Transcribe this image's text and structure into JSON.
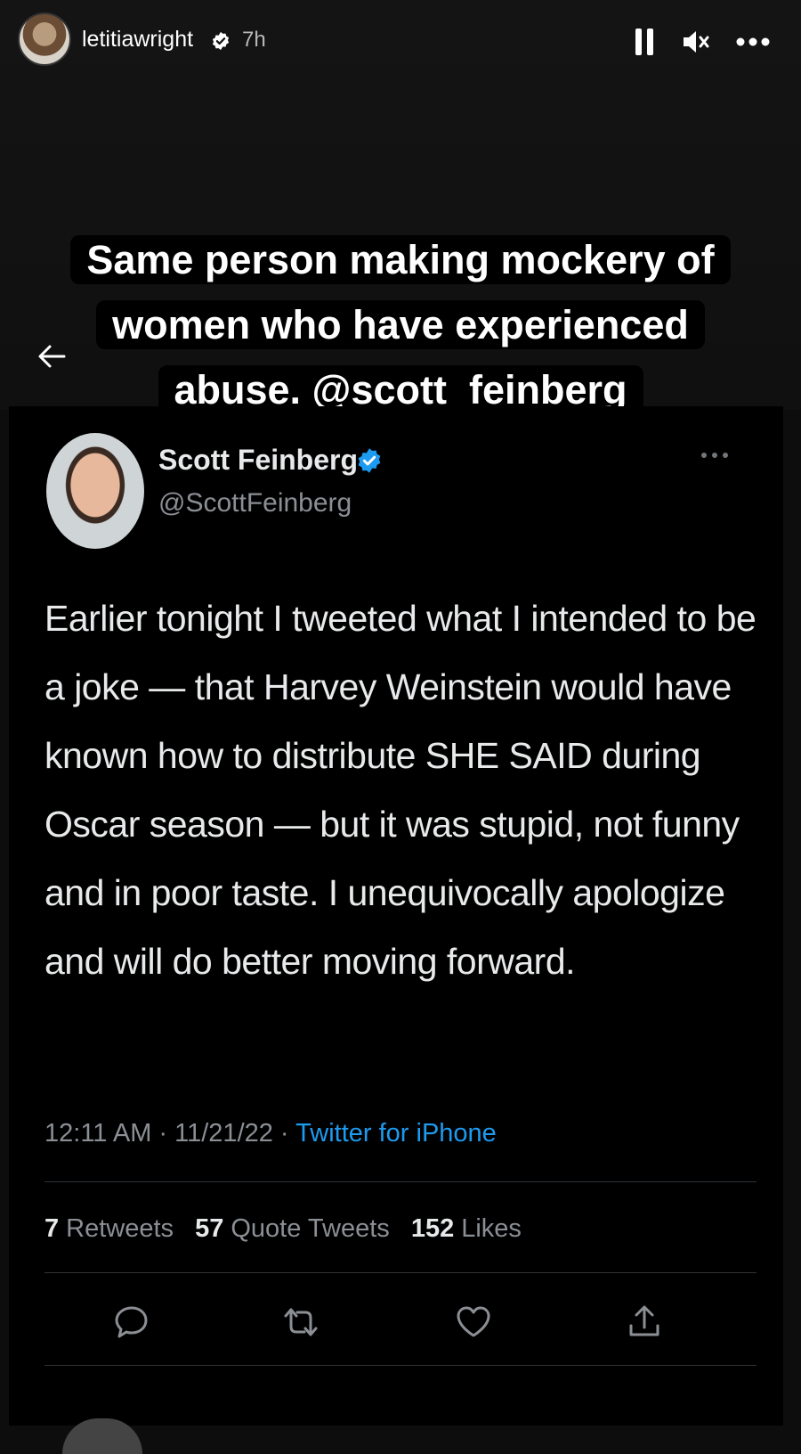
{
  "story": {
    "username": "letitiawright",
    "time": "7h",
    "caption_lines": [
      "Same person making mockery of",
      "women who have experienced",
      "abuse. @scott_feinberg"
    ]
  },
  "tweet": {
    "name": "Scott Feinberg",
    "handle": "@ScottFeinberg",
    "text": "Earlier tonight I tweeted what I intended to be a joke — that Harvey Weinstein would have known how to distribute SHE SAID during Oscar season — but it was stupid, not funny and in poor taste. I unequivocally apologize and will do better moving forward.",
    "timestamp": "12:11 AM · 11/21/22 · ",
    "source": "Twitter for iPhone",
    "retweets": "7",
    "retweets_label": "Retweets",
    "quotes": "57",
    "quotes_label": "Quote Tweets",
    "likes": "152",
    "likes_label": "Likes"
  },
  "colors": {
    "background": "#0d0d0d",
    "tweet_bg": "#000000",
    "link_blue": "#1d9bf0",
    "verified_blue": "#1d9bf0",
    "muted_text": "#8b8f94"
  },
  "icons": [
    "verified-badge-icon",
    "pause-icon",
    "mute-icon",
    "more-icon",
    "back-arrow-icon",
    "reply-icon",
    "retweet-icon",
    "like-icon",
    "share-icon"
  ]
}
